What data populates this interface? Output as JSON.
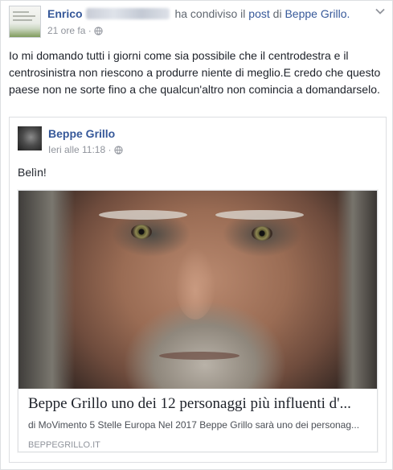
{
  "post": {
    "author_name": "Enrico",
    "shared_text": "ha condiviso il",
    "post_link": "post",
    "of_text": "di",
    "source_page": "Beppe Grillo.",
    "time": "21 ore fa",
    "dot": "·",
    "message": "Io mi domando tutti i giorni come sia possibile che il centrodestra e il centrosinistra non riescono a produrre niente di meglio.E credo che questo paese non ne sorte fino a che qualcun'altro non comincia a domandarselo."
  },
  "shared": {
    "author": "Beppe Grillo",
    "time": "Ieri alle 11:18",
    "dot": "·",
    "text": "Belìn!"
  },
  "article": {
    "title": "Beppe Grillo uno dei 12 personaggi più influenti d'...",
    "description": "di MoVimento 5 Stelle Europa Nel 2017 Beppe Grillo sarà uno dei personag...",
    "domain": "BEPPEGRILLO.IT"
  },
  "colors": {
    "link": "#365899",
    "meta": "#90949c",
    "text": "#1d2129",
    "border": "#dddfe2"
  },
  "icons": {
    "privacy": "globe-icon",
    "options": "chevron-down-icon"
  }
}
